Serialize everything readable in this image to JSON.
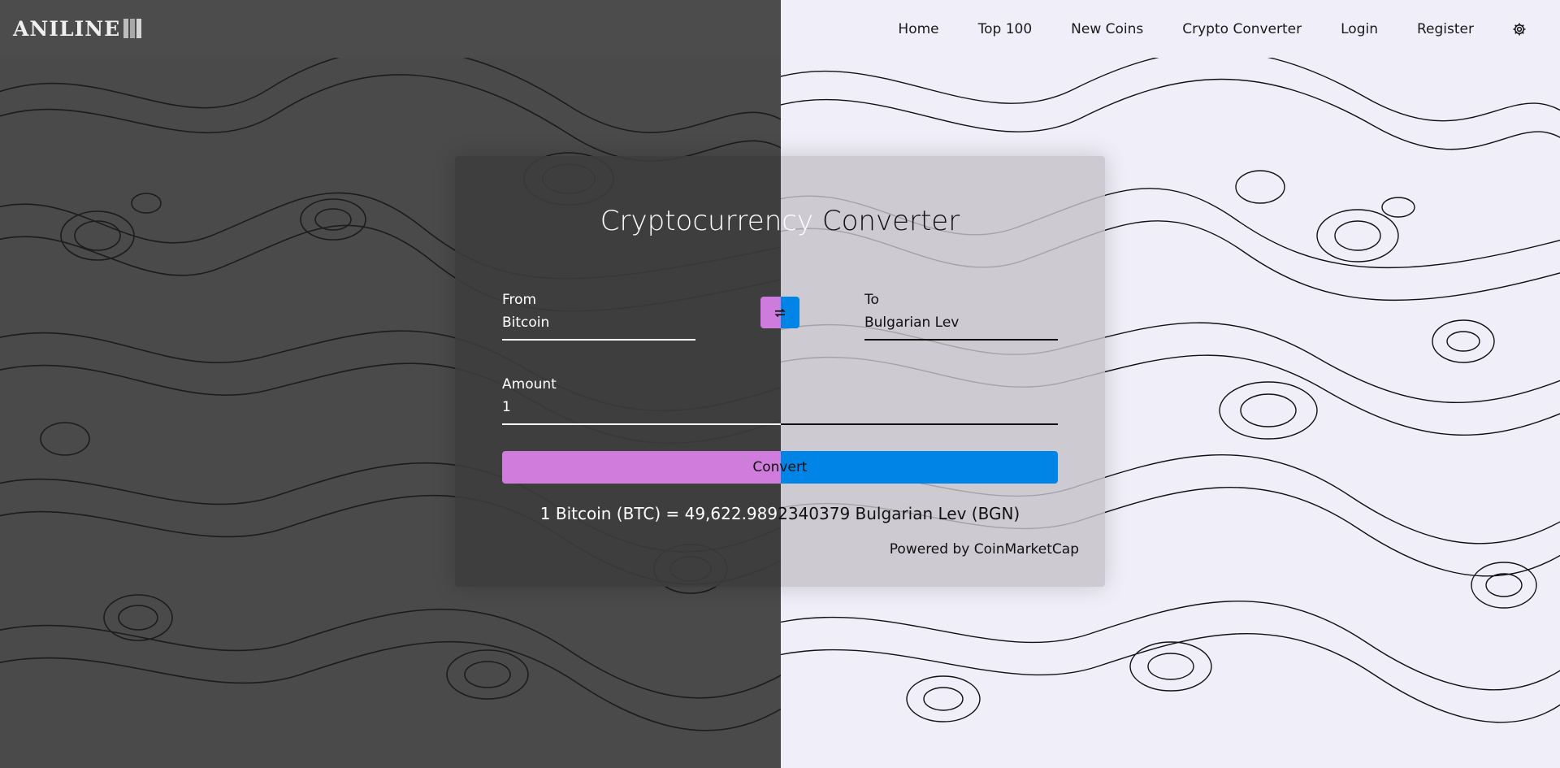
{
  "brand": {
    "name": "ANILINE"
  },
  "nav": {
    "items": [
      {
        "label": "Home"
      },
      {
        "label": "Top 100"
      },
      {
        "label": "New Coins"
      },
      {
        "label": "Crypto Converter"
      },
      {
        "label": "Login"
      },
      {
        "label": "Register"
      }
    ],
    "theme_icon": "gear-icon"
  },
  "converter": {
    "title_left": "Cryptocurrency",
    "title_right": " Converter",
    "from": {
      "label": "From",
      "value": "Bitcoin"
    },
    "to": {
      "label": "To",
      "value": "Bulgarian Lev"
    },
    "swap_icon": "swap-arrows-icon",
    "amount": {
      "label": "Amount",
      "value": "1"
    },
    "convert_label": "Convert",
    "result_left": "1 Bitcoin (BTC) = 49,622.989",
    "result_right": "2340379 Bulgarian Lev (BGN)",
    "powered_by": "Powered by CoinMarketCap"
  },
  "colors": {
    "accent_pink": "#cd7bdc",
    "accent_blue": "#0085e6",
    "dark_side": "#4a4a4a",
    "light_side": "#f0eef8"
  }
}
